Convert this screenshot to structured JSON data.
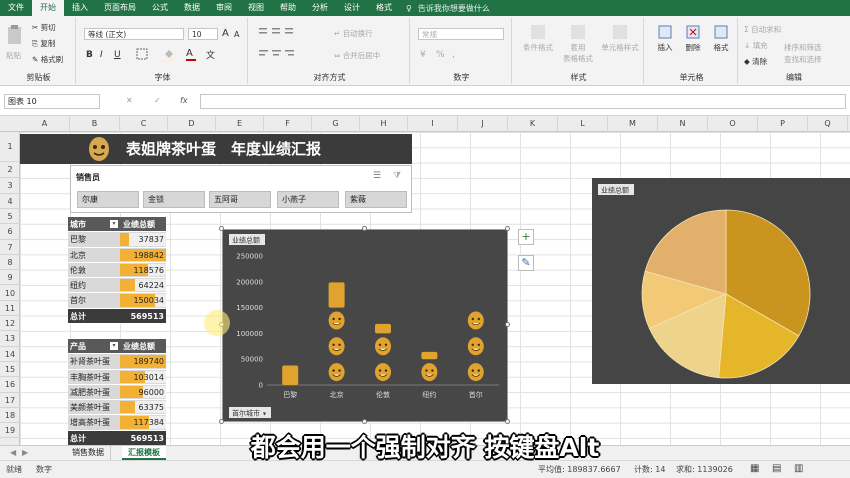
{
  "ribbon_tabs": [
    "文件",
    "开始",
    "插入",
    "页面布局",
    "公式",
    "数据",
    "审阅",
    "视图",
    "帮助",
    "分析",
    "设计",
    "格式"
  ],
  "tell_me": "告诉我你想要做什么",
  "clipboard": {
    "paste": "粘贴",
    "cut": "剪切",
    "copy": "复制",
    "format_painter": "格式刷",
    "label": "剪贴板"
  },
  "font_group": {
    "font_name": "等线 (正文)",
    "font_size": "10",
    "bold": "B",
    "italic": "I",
    "underline": "U",
    "label": "字体",
    "font_color_glyph": "A",
    "grow": "A",
    "shrink": "A"
  },
  "align_group": {
    "wrap": "自动换行",
    "merge": "合并后居中",
    "label": "对齐方式"
  },
  "number_group": {
    "format": "常规",
    "label": "数字",
    "percent": "%",
    "comma": ",",
    "currency": "¥"
  },
  "styles_group": {
    "cond": "条件格式",
    "table": "套用\n表格格式",
    "cell": "单元格样式",
    "label": "样式"
  },
  "cells_group": {
    "insert": "插入",
    "delete": "删除",
    "format": "格式",
    "label": "单元格"
  },
  "editing_group": {
    "autosum": "自动求和",
    "fill": "填充",
    "clear": "清除",
    "sort": "排序和筛选",
    "find": "查找和选择",
    "label": "编辑"
  },
  "name_box": "图表 10",
  "formula_bar": {
    "cancel": "✕",
    "enter": "✓",
    "fx": "fx"
  },
  "columns": [
    "A",
    "B",
    "C",
    "D",
    "E",
    "F",
    "G",
    "H",
    "I",
    "J",
    "K",
    "L",
    "M",
    "N",
    "O",
    "P",
    "Q"
  ],
  "rows": [
    "1",
    "2",
    "3",
    "4",
    "5",
    "6",
    "7",
    "8",
    "9",
    "10",
    "11",
    "12",
    "13",
    "14",
    "15",
    "16",
    "17",
    "18",
    "19"
  ],
  "dashboard_title": "表姐牌茶叶蛋　年度业绩汇报",
  "slicer": {
    "title": "销售员",
    "items": [
      "尔康",
      "金锁",
      "五阿哥",
      "小燕子",
      "紫薇"
    ]
  },
  "pivot_city": {
    "header_label": "城市",
    "header_value": "业绩总额",
    "rows": [
      {
        "label": "巴黎",
        "value": "37837",
        "pct": 0.19
      },
      {
        "label": "北京",
        "value": "198842",
        "pct": 1.0
      },
      {
        "label": "伦敦",
        "value": "118576",
        "pct": 0.6
      },
      {
        "label": "纽约",
        "value": "64224",
        "pct": 0.32
      },
      {
        "label": "首尔",
        "value": "150034",
        "pct": 0.75
      }
    ],
    "total_label": "总计",
    "total_value": "569513"
  },
  "pivot_product": {
    "header_label": "产品",
    "header_value": "业绩总额",
    "rows": [
      {
        "label": "补肾茶叶蛋",
        "value": "189740",
        "pct": 1.0
      },
      {
        "label": "丰胸茶叶蛋",
        "value": "103014",
        "pct": 0.54
      },
      {
        "label": "减肥茶叶蛋",
        "value": "96000",
        "pct": 0.51
      },
      {
        "label": "美颜茶叶蛋",
        "value": "63375",
        "pct": 0.33
      },
      {
        "label": "增高茶叶蛋",
        "value": "117384",
        "pct": 0.62
      }
    ],
    "total_label": "总计",
    "total_value": "569513"
  },
  "chart_data": [
    {
      "type": "bar",
      "title": "业绩总额",
      "categories": [
        "巴黎",
        "北京",
        "伦敦",
        "纽约",
        "首尔"
      ],
      "values": [
        37837,
        198842,
        118576,
        64224,
        150034
      ],
      "yticks": [
        "250000",
        "200000",
        "150000",
        "100000",
        "50000",
        "0"
      ],
      "ylim": [
        0,
        250000
      ],
      "axis_field_button": "首尔城市"
    },
    {
      "type": "pie",
      "title": "业绩总额",
      "values": [
        189740,
        103014,
        96000,
        63375,
        117384
      ],
      "colors": [
        "#c9951f",
        "#e6b62a",
        "#eed38a",
        "#f1c977",
        "#e2b06a"
      ]
    }
  ],
  "chart_side_buttons": {
    "add": "+",
    "style": "✎"
  },
  "sheet_tabs": [
    "销售数据",
    "汇报模板"
  ],
  "status": {
    "mode": "就绪",
    "num": "数字",
    "average": "平均值: 189837.6667",
    "count": "计数: 14",
    "sum": "求和: 1139026"
  },
  "subtitle": "都会用一个强制对齐 按键盘Alt"
}
